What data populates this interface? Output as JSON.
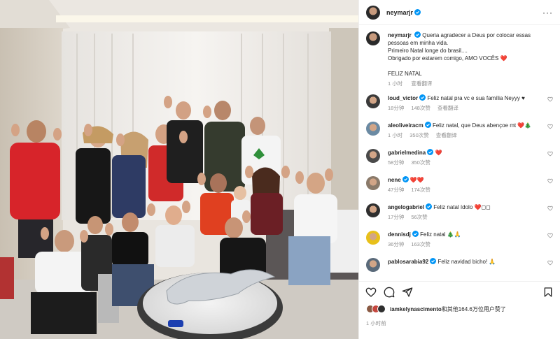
{
  "post": {
    "author": "neymarjr",
    "verified": true
  },
  "caption": {
    "author": "neymarjr",
    "lines": [
      "Queria agradecer a Deus por colocar essas pessoas em minha vida.",
      "Primeiro Natal longe do brasil....",
      "Obrigado por estarem comigo, AMO VOCÊS ❤️",
      "",
      "FELIZ NATAL"
    ],
    "time": "1 小时",
    "translate": "查看翻译"
  },
  "comments": [
    {
      "user": "loud_victor",
      "text": "Feliz natal pra vc e sua família Neyyy ♥",
      "time": "18分钟",
      "likes": "148次赞",
      "translate": "查看翻译",
      "avatar_color": "#3a3a3a"
    },
    {
      "user": "aleoliveiracm",
      "text": "Feliz natal, que Deus abençoe mt ❤️🎄",
      "time": "1 小时",
      "likes": "350次赞",
      "translate": "查看翻译",
      "avatar_color": "#6b8aa3"
    },
    {
      "user": "gabrielmedina",
      "text": "❤️",
      "time": "58分钟",
      "likes": "350次赞",
      "translate": "",
      "avatar_color": "#4a4a4a"
    },
    {
      "user": "nene",
      "text": "❤️❤️",
      "time": "47分钟",
      "likes": "174次赞",
      "translate": "",
      "avatar_color": "#8a7a6a"
    },
    {
      "user": "angelogabriel",
      "text": "Feliz natal ídolo ❤️◻◻",
      "time": "17分钟",
      "likes": "56次赞",
      "translate": "",
      "avatar_color": "#2f2f2f"
    },
    {
      "user": "dennisdj",
      "text": "Feliz natal 🎄🙏",
      "time": "36分钟",
      "likes": "163次赞",
      "translate": "",
      "avatar_color": "#e8c01a"
    },
    {
      "user": "pablosarabia92",
      "text": "Feliz navidad bicho! 🙏",
      "time": "",
      "likes": "",
      "translate": "",
      "avatar_color": "#5a6a7a"
    }
  ],
  "likes_line": {
    "user": "iamkelynascimento",
    "rest": "和其他164.6万位用户赞了"
  },
  "post_time": "1 小时前",
  "colors": {
    "verified": "#0095f6",
    "heart": "#ed4956",
    "muted": "#8e8e8e",
    "text": "#262626"
  }
}
